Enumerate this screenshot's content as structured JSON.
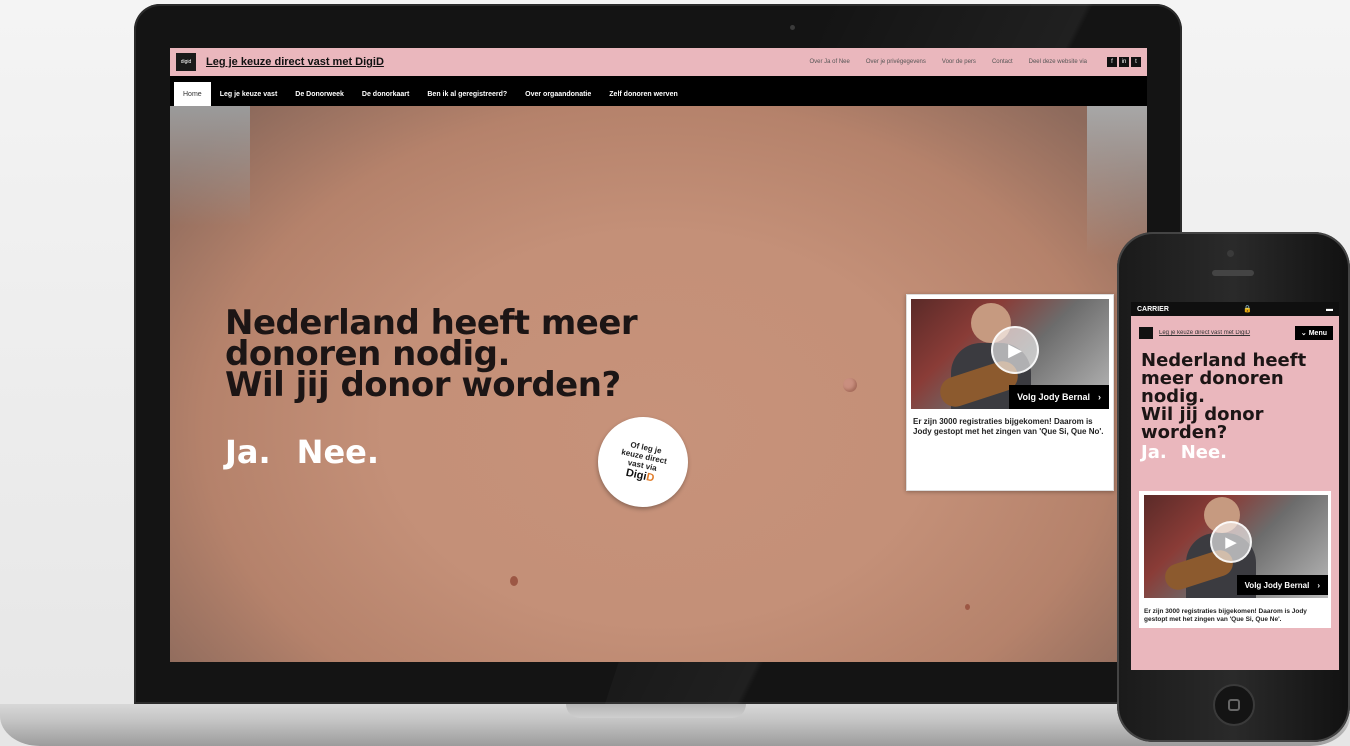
{
  "laptop": {
    "site_logo_text": "digid",
    "site_title": "Leg je keuze direct vast met DigiD",
    "top_links": [
      "Over Ja of Nee",
      "Over je privégegevens",
      "Voor de pers",
      "Contact",
      "Deel deze website via"
    ],
    "social_icons": [
      "f",
      "in",
      "t"
    ],
    "nav": [
      "Home",
      "Leg je keuze vast",
      "De Donorweek",
      "De donorkaart",
      "Ben ik al geregistreerd?",
      "Over orgaandonatie",
      "Zelf donoren werven"
    ],
    "headline": "Nederland heeft meer donoren nodig. Wil jij donor worden?",
    "headline_line1": "Nederland heeft meer",
    "headline_line2": "donoren nodig.",
    "headline_line3": "Wil jij donor worden?",
    "yes": "Ja.",
    "no": "Nee.",
    "badge": {
      "line1": "Of leg je",
      "line2": "keuze direct",
      "line3": "vast via",
      "digid_prefix": "Digi",
      "digid_suffix": "D"
    },
    "video": {
      "follow_label": "Volg Jody Bernal",
      "caption": "Er zijn 3000 registraties bijgekomen! Daarom is Jody gestopt met het zingen van 'Que Si, Que No'."
    }
  },
  "phone": {
    "carrier": "CARRIER",
    "site_title": "Leg je keuze direct vast met DigiD",
    "menu_label": "Menu",
    "headline_line1": "Nederland heeft",
    "headline_line2": "meer donoren",
    "headline_line3": "nodig.",
    "headline_line4": "Wil jij donor",
    "headline_line5": "worden?",
    "yes": "Ja.",
    "no": "Nee.",
    "video": {
      "follow_label": "Volg Jody Bernal",
      "caption": "Er zijn 3000 registraties bijgekomen! Daarom is Jody gestopt met het zingen van 'Que Si, Que Ne'."
    }
  },
  "colors": {
    "brand_pink": "#eab7bd",
    "nav_black": "#000000",
    "accent_orange": "#e07b28"
  }
}
